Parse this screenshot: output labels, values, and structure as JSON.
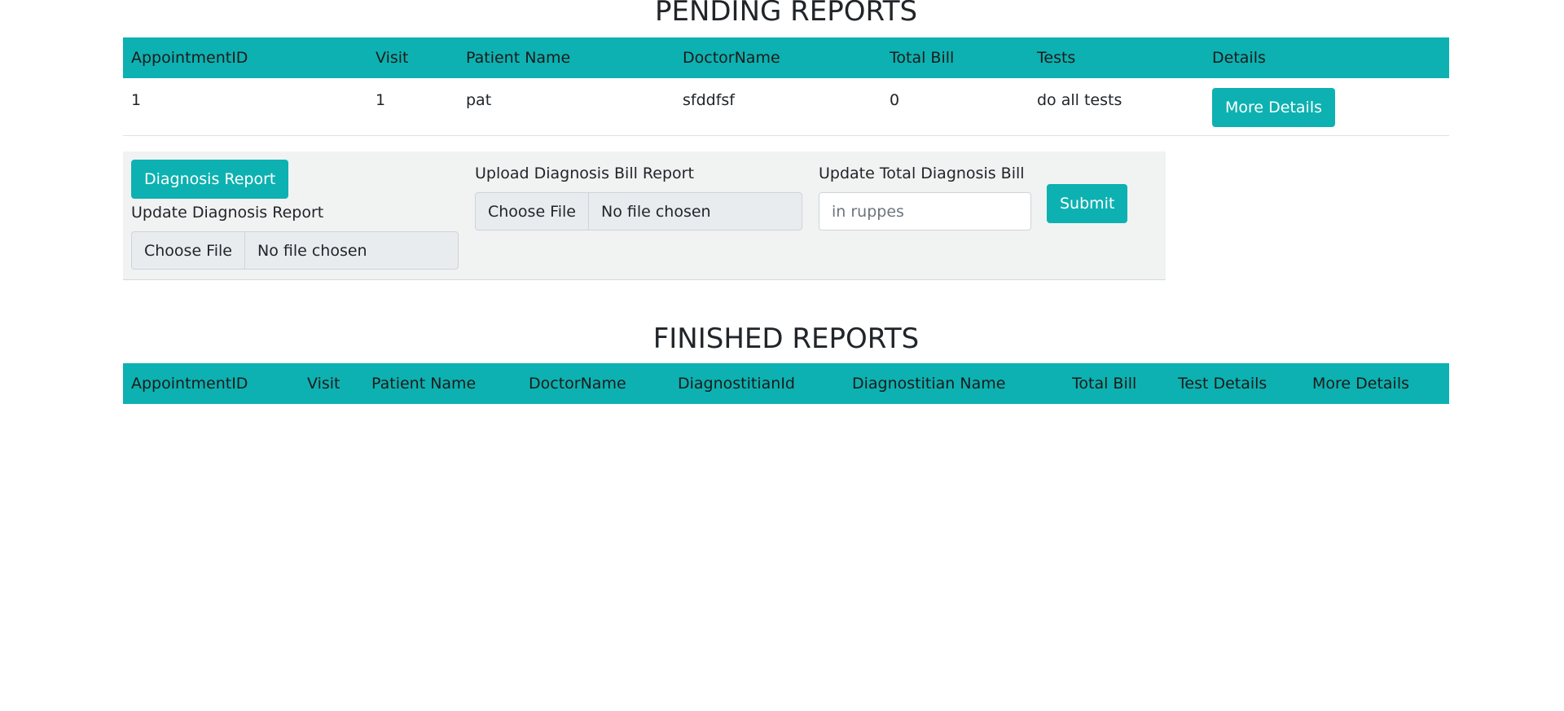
{
  "pending": {
    "title": "PENDING REPORTS",
    "headers": [
      "AppointmentID",
      "Visit",
      "Patient Name",
      "DoctorName",
      "Total Bill",
      "Tests",
      "Details"
    ],
    "rows": [
      {
        "appointment_id": "1",
        "visit": "1",
        "patient_name": "pat",
        "doctor_name": "sfddfsf",
        "total_bill": "0",
        "tests": "do all tests",
        "details_button": "More Details"
      }
    ]
  },
  "upload": {
    "diagnosis_button": "Diagnosis Report",
    "update_report_label": "Update Diagnosis Report",
    "update_report_file": {
      "button": "Choose File",
      "status": "No file chosen"
    },
    "bill_report_label": "Upload Diagnosis Bill Report",
    "bill_report_file": {
      "button": "Choose File",
      "status": "No file chosen"
    },
    "total_bill_label": "Update Total Diagnosis Bill",
    "total_bill_placeholder": "in ruppes",
    "submit_button": "Submit"
  },
  "finished": {
    "title": "FINISHED REPORTS",
    "headers": [
      "AppointmentID",
      "Visit",
      "Patient Name",
      "DoctorName",
      "DiagnostitianId",
      "Diagnostitian Name",
      "Total Bill",
      "Test Details",
      "More Details"
    ],
    "rows": []
  },
  "colors": {
    "accent": "#0db1b1",
    "panel_bg": "#f1f2f2"
  }
}
